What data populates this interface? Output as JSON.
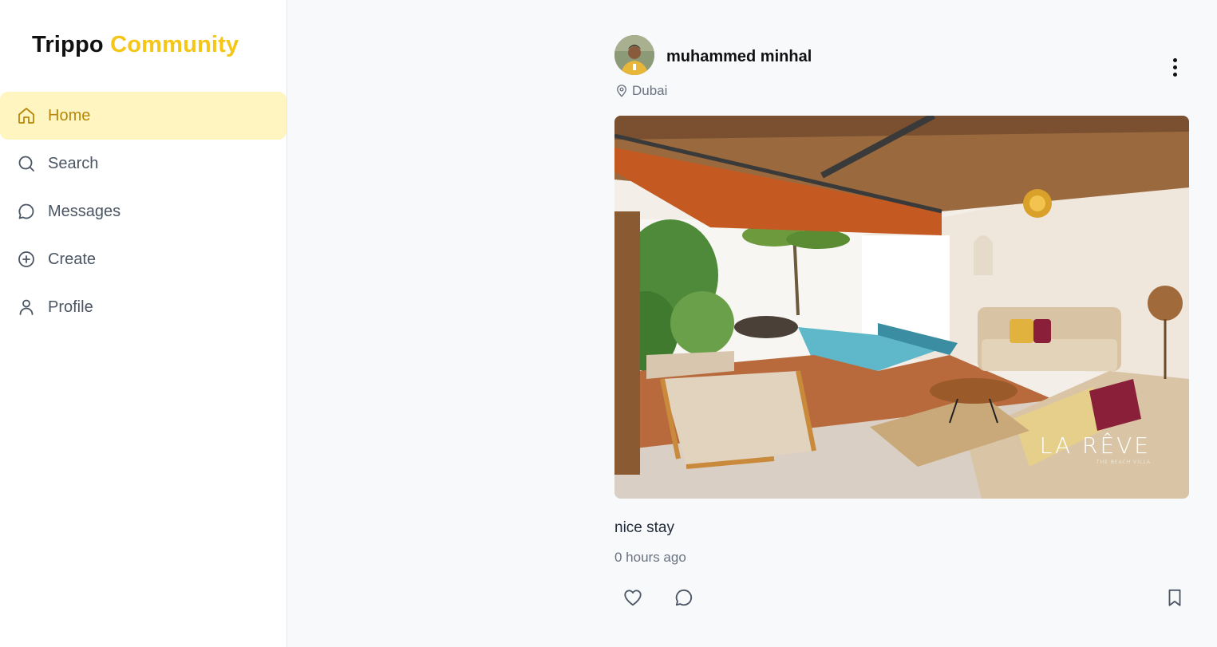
{
  "brand": {
    "part1": "Trippo",
    "part2": "Community",
    "accent_color": "#f5c518"
  },
  "sidebar": {
    "items": [
      {
        "label": "Home",
        "icon": "home-icon",
        "active": true
      },
      {
        "label": "Search",
        "icon": "search-icon",
        "active": false
      },
      {
        "label": "Messages",
        "icon": "message-icon",
        "active": false
      },
      {
        "label": "Create",
        "icon": "plus-circle-icon",
        "active": false
      },
      {
        "label": "Profile",
        "icon": "user-icon",
        "active": false
      }
    ],
    "active_bg": "#fef5c0",
    "active_color": "#b7870b"
  },
  "post": {
    "username": "muhammed minhal",
    "location": "Dubai",
    "caption": "nice stay",
    "time": "0 hours ago",
    "image_alt": "villa patio with pool",
    "watermark": "LA RÊVE",
    "watermark_sub": "THE BEACH VILLA",
    "icons": {
      "more": "more-vertical-icon",
      "like": "heart-icon",
      "comment": "comment-icon",
      "save": "bookmark-icon"
    }
  }
}
